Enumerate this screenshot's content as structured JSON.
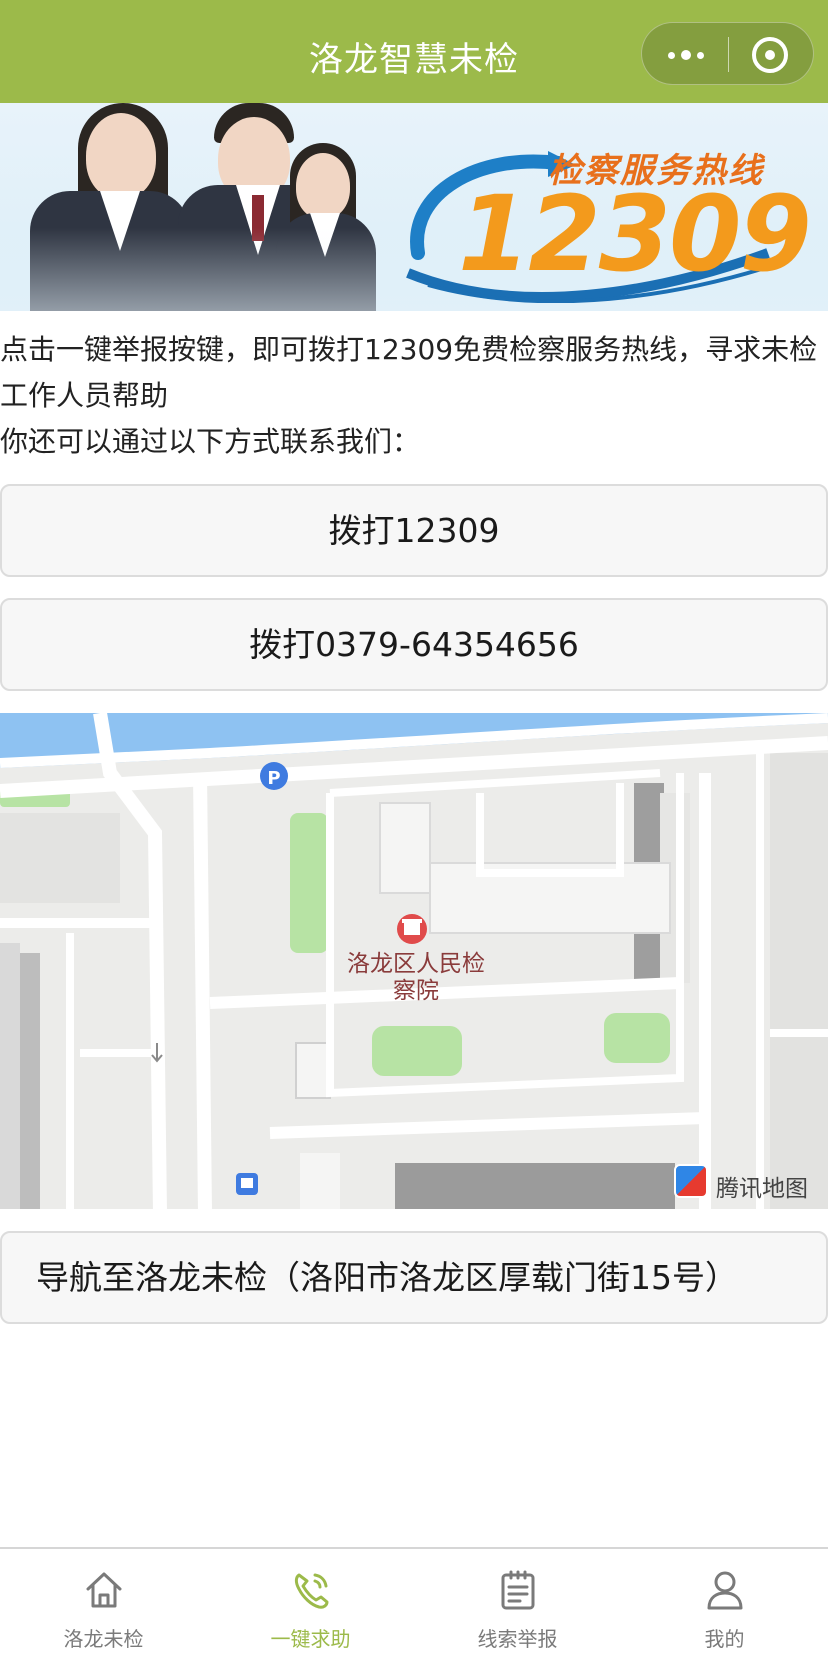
{
  "app": {
    "title": "洛龙智慧未检",
    "accent_color": "#9cba4a"
  },
  "banner": {
    "hotline_title": "检察服务热线",
    "hotline_number": "12309"
  },
  "intro": {
    "line1": "点击一键举报按键，即可拨打12309免费检察服务热线，寻求未检工作人员帮助",
    "line2": "你还可以通过以下方式联系我们："
  },
  "actions": {
    "call_12309": "拨打12309",
    "call_office": "拨打0379-64354656",
    "navigate": "导航至洛龙未检（洛阳市洛龙区厚载门街15号）"
  },
  "map": {
    "poi_name": "洛龙区人民检察院",
    "provider": "腾讯地图"
  },
  "tabbar": {
    "items": [
      {
        "label": "洛龙未检",
        "icon": "home-icon",
        "active": false
      },
      {
        "label": "一键求助",
        "icon": "phone-icon",
        "active": true
      },
      {
        "label": "线索举报",
        "icon": "clipboard-icon",
        "active": false
      },
      {
        "label": "我的",
        "icon": "user-icon",
        "active": false
      }
    ]
  }
}
